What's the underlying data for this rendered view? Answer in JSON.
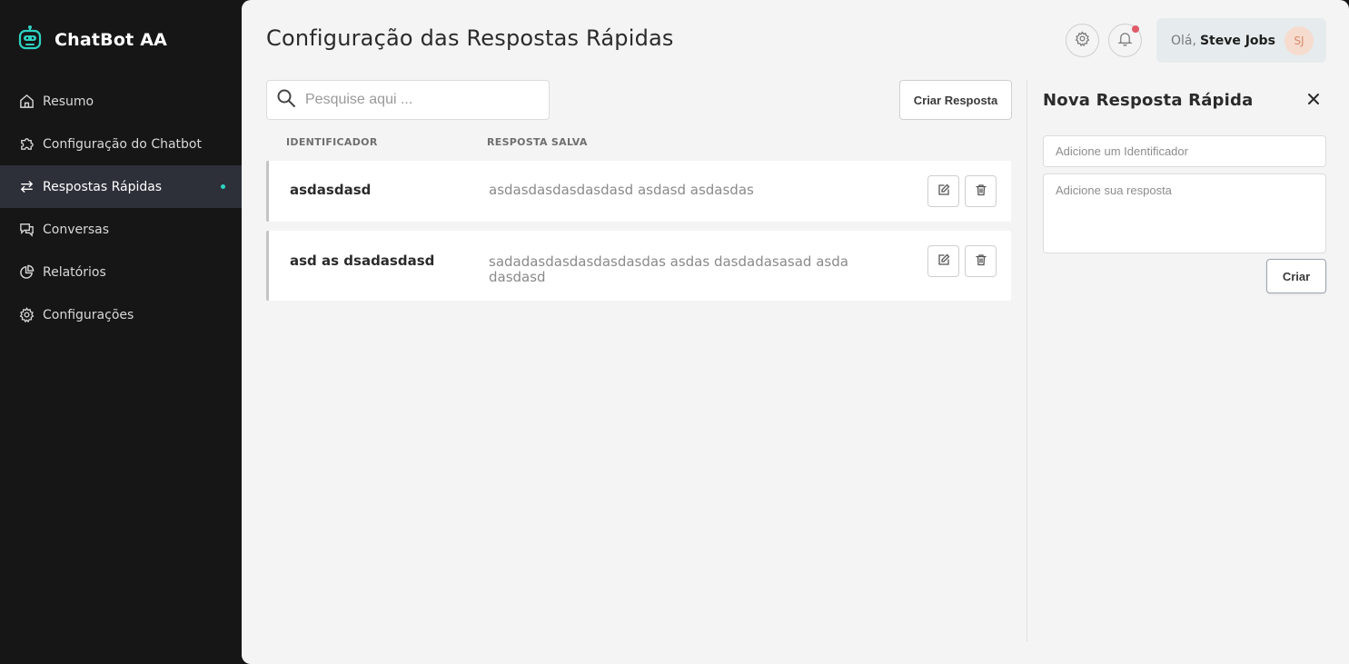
{
  "brand": {
    "name": "ChatBot AA",
    "icon": "robot-icon",
    "accent": "#2ed3c2"
  },
  "sidebar": {
    "items": [
      {
        "label": "Resumo",
        "icon": "home-icon",
        "active": false
      },
      {
        "label": "Configuração do Chatbot",
        "icon": "puzzle-icon",
        "active": false
      },
      {
        "label": "Respostas Rápidas",
        "icon": "arrows-exchange-icon",
        "active": true
      },
      {
        "label": "Conversas",
        "icon": "chat-bubbles-icon",
        "active": false
      },
      {
        "label": "Relatórios",
        "icon": "pie-chart-icon",
        "active": false
      },
      {
        "label": "Configurações",
        "icon": "gear-icon",
        "active": false
      }
    ]
  },
  "header": {
    "title": "Configuração das Respostas Rápidas",
    "settings_icon": "gear-icon",
    "notifications_icon": "bell-icon",
    "user": {
      "greeting": "Olá,",
      "name": "Steve Jobs",
      "initials": "SJ"
    }
  },
  "search": {
    "placeholder": "Pesquise aqui ...",
    "value": ""
  },
  "toolbar": {
    "create_label": "Criar Resposta"
  },
  "table": {
    "headers": {
      "identifier": "IDENTIFICADOR",
      "response": "RESPOSTA SALVA"
    },
    "rows": [
      {
        "identifier": "asdasdasd",
        "response": "asdasdasdasdasdasd asdasd asdasdas"
      },
      {
        "identifier": "asd as dsadasdasd",
        "response": "sadadasdasdasdasdasdas asdas dasdadasasad asda dasdasd"
      }
    ]
  },
  "new_reply_panel": {
    "title": "Nova Resposta Rápida",
    "identifier_placeholder": "Adicione um Identificador",
    "response_placeholder": "Adicione sua resposta",
    "submit_label": "Criar"
  }
}
